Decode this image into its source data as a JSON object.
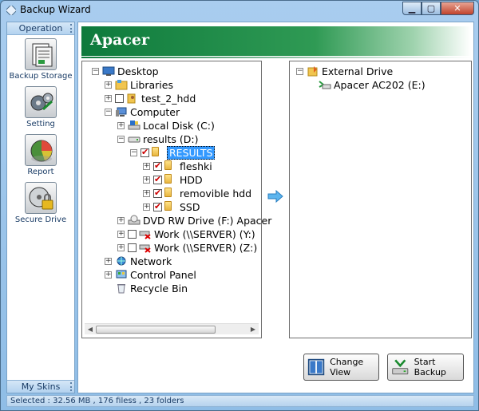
{
  "window": {
    "title": "Backup Wizard"
  },
  "sidebar": {
    "header": "Operation",
    "footer": "My Skins",
    "items": [
      {
        "label": "Backup Storage",
        "icon": "backup-storage-icon"
      },
      {
        "label": "Setting",
        "icon": "gear-icon"
      },
      {
        "label": "Report",
        "icon": "report-chart-icon"
      },
      {
        "label": "Secure Drive",
        "icon": "lock-drive-icon"
      }
    ]
  },
  "banner": {
    "brand": "Apacer"
  },
  "source_tree": {
    "nodes": [
      {
        "label": "Desktop"
      },
      {
        "label": "Libraries"
      },
      {
        "label": "test_2_hdd"
      },
      {
        "label": "Computer"
      },
      {
        "label": "Local Disk (C:)"
      },
      {
        "label": "results (D:)"
      },
      {
        "label": "RESULTS"
      },
      {
        "label": "fleshki"
      },
      {
        "label": "HDD"
      },
      {
        "label": "removible hdd"
      },
      {
        "label": "SSD"
      },
      {
        "label": "DVD RW Drive (F:) Apacer"
      },
      {
        "label": "Work (\\\\SERVER) (Y:)"
      },
      {
        "label": "Work (\\\\SERVER) (Z:)"
      },
      {
        "label": "Network"
      },
      {
        "label": "Control Panel"
      },
      {
        "label": "Recycle Bin"
      }
    ]
  },
  "target_tree": {
    "nodes": [
      {
        "label": "External Drive"
      },
      {
        "label": "Apacer AC202 (E:)"
      }
    ]
  },
  "buttons": {
    "change_view": "Change View",
    "start_backup": "Start Backup"
  },
  "status": {
    "text": "Selected : 32.56 MB , 176 filess , 23 folders"
  },
  "colors": {
    "brand_green": "#0e7a3c",
    "selection": "#3399ff",
    "frame_blue": "#8fbde6"
  }
}
